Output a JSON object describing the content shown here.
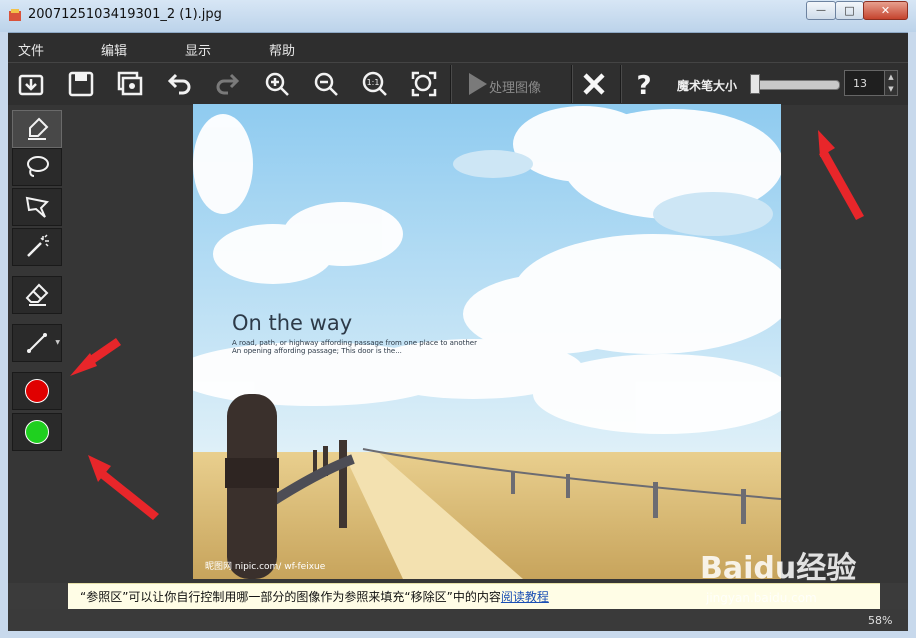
{
  "window": {
    "title": "2007125103419301_2 (1).jpg",
    "controls": {
      "minimize": "—",
      "maximize": "□",
      "close": "✕"
    }
  },
  "menu": [
    "文件",
    "编辑",
    "显示",
    "帮助"
  ],
  "toolbar": {
    "process_label": "处理图像",
    "brush_size_label": "魔术笔大小",
    "brush_size_value": "13",
    "spin_up": "▲",
    "spin_down": "▼"
  },
  "left_tools": [
    {
      "name": "marker-pen-icon"
    },
    {
      "name": "lasso-icon"
    },
    {
      "name": "polygon-lasso-icon"
    },
    {
      "name": "magic-wand-icon"
    },
    {
      "name": "eraser-icon"
    },
    {
      "name": "line-tool-icon"
    },
    {
      "name": "red-color-swatch",
      "color": "#e00000"
    },
    {
      "name": "green-color-swatch",
      "color": "#1fd01f"
    }
  ],
  "image": {
    "headline": "On the way",
    "subtitle_line1": "A road, path, or highway affording passage from one place to another",
    "subtitle_line2": "An opening affording passage; This door is the...",
    "watermark": "昵图网 nipic.com/ wf-feixue"
  },
  "hint": {
    "text": "“参照区”可以让你自行控制用哪一部分的图像作为参照来填充“移除区”中的内容",
    "link": "阅读教程"
  },
  "status": {
    "zoom": "58%"
  },
  "overlay": {
    "baidu": "Baidu经验",
    "baidu_sub": "jingyan.baidu.com"
  },
  "colors": {
    "accent_arrow": "#e8262a",
    "red_swatch": "#e00000",
    "green_swatch": "#1fd01f"
  }
}
